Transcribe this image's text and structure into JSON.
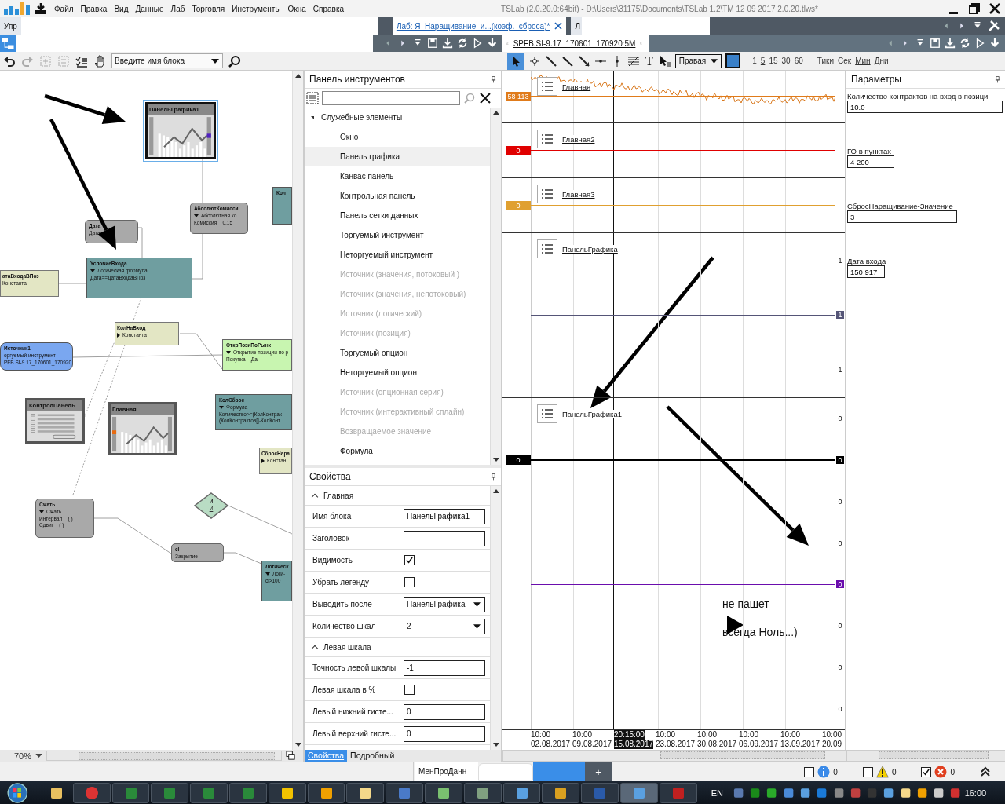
{
  "title_bar": {
    "menu": [
      "Файл",
      "Правка",
      "Вид",
      "Данные",
      "Лаб",
      "Торговля",
      "Инструменты",
      "Окна",
      "Справка"
    ],
    "title": "TSLab (2.0.20.0:64bit) - D:\\Users\\31175\\Documents\\TSLab 1.2\\TM 12 09 2017 2.0.20.tlws*"
  },
  "document_tabs": [
    {
      "label": "Упр",
      "selected": false
    },
    {
      "label": "Лаб: Я_Наращивание_и...(коэф._сброса)*",
      "selected": true
    },
    {
      "label": "Л",
      "selected": false
    }
  ],
  "chart_tab": {
    "label": "SPFB.SI-9.17_170601_170920:5M"
  },
  "editor_toolbar": {
    "block_search": {
      "placeholder": "Введите имя блока"
    }
  },
  "chart_toolbar": {
    "text_tool": "T",
    "scale": "Правая",
    "periods": [
      {
        "label": "1",
        "selected": false
      },
      {
        "label": "5",
        "selected": true
      },
      {
        "label": "15",
        "selected": false
      },
      {
        "label": "30",
        "selected": false
      },
      {
        "label": "60",
        "selected": false
      }
    ],
    "units": [
      {
        "label": "Тики",
        "selected": false
      },
      {
        "label": "Сек",
        "selected": false
      },
      {
        "label": "Мин",
        "selected": true
      },
      {
        "label": "Дни",
        "selected": false
      }
    ]
  },
  "canvas": {
    "zoom": "70%",
    "nodes": [
      {
        "kind": "panel",
        "title": "ПанельГрафика1",
        "selected": true
      },
      {
        "kind": "gray",
        "title": "Дата",
        "subtitle": "Дата",
        "selected": false
      },
      {
        "kind": "gray",
        "title": "АбсолютКомисси",
        "subtitle": {
          "text": "Абсолютная ко...",
          "expanded": true
        },
        "lines": [
          {
            "label": "Комиссия",
            "value": "0.15"
          }
        ],
        "selected": false
      },
      {
        "kind": "teal",
        "title": "Кол",
        "selected": false
      },
      {
        "kind": "teal",
        "title": "УсловиеВхода",
        "subtitle": {
          "text": "Логическая формула",
          "expanded": true
        },
        "lines": [
          "Дата==ДатаВходаВПоз"
        ],
        "selected": false
      },
      {
        "kind": "yellow",
        "title": "атаВходаВПоз",
        "subtitle": "Константа",
        "selected": false
      },
      {
        "kind": "yellow",
        "title": "КолНаВход",
        "subtitle": {
          "text": "Константа",
          "expanded": false
        },
        "selected": false
      },
      {
        "kind": "blue",
        "title": "Источник1",
        "subtitle": "оргуемый инструмент",
        "lines": [
          "PFB.SI-9.17_170601_170920"
        ],
        "selected": false
      },
      {
        "kind": "green",
        "title": "ОткрПозиПоРынк",
        "subtitle": {
          "text": "Открытие позиции по р",
          "expanded": true
        },
        "lines": [
          {
            "label": "Покупка",
            "value": "Да"
          }
        ],
        "selected": false
      },
      {
        "kind": "control",
        "title": "КонтролПанель",
        "selected": false
      },
      {
        "kind": "panel",
        "title": "Главная",
        "selected": false
      },
      {
        "kind": "teal",
        "title": "КолСброс",
        "subtitle": {
          "text": "Формула",
          "expanded": true
        },
        "lines": [
          "Количество>=(КолКонтрак",
          "(КолКонтрактов[]-КолКонт"
        ],
        "selected": false
      },
      {
        "kind": "yellow",
        "title": "СбросНара",
        "subtitle": {
          "text": "Констан",
          "expanded": false
        },
        "selected": false
      },
      {
        "kind": "diamond",
        "title": "И",
        "subtitle": "И",
        "selected": false
      },
      {
        "kind": "gray",
        "title": "Сжать",
        "subtitle": {
          "text": "Сжать",
          "expanded": true
        },
        "lines": [
          {
            "label": "Интервал",
            "value": "( )"
          },
          {
            "label": "Сдвиг",
            "value": "( )"
          }
        ],
        "selected": false
      },
      {
        "kind": "gray",
        "title": "cl",
        "subtitle": "Закрытие",
        "selected": false
      },
      {
        "kind": "teal",
        "title": "Логическ",
        "subtitle": {
          "text": "Логи-",
          "expanded": true
        },
        "lines": [
          "cl>100"
        ],
        "selected": false
      }
    ]
  },
  "toolbox": {
    "title": "Панель инструментов",
    "group": {
      "label": "Служебные элементы",
      "expanded": true,
      "items": [
        {
          "label": "Окно",
          "selected": false,
          "disabled": false
        },
        {
          "label": "Панель графика",
          "selected": true,
          "disabled": false
        },
        {
          "label": "Канвас панель",
          "selected": false,
          "disabled": false
        },
        {
          "label": "Контрольная панель",
          "selected": false,
          "disabled": false
        },
        {
          "label": "Панель сетки данных",
          "selected": false,
          "disabled": false
        },
        {
          "label": "Торгуемый инструмент",
          "selected": false,
          "disabled": false
        },
        {
          "label": "Неторгуемый инструмент",
          "selected": false,
          "disabled": false
        },
        {
          "label": "Источник (значения, потоковый )",
          "selected": false,
          "disabled": true
        },
        {
          "label": "Источник (значения, непотоковый)",
          "selected": false,
          "disabled": true
        },
        {
          "label": "Источник (логический)",
          "selected": false,
          "disabled": true
        },
        {
          "label": "Источник (позиция)",
          "selected": false,
          "disabled": true
        },
        {
          "label": "Торгуемый опцион",
          "selected": false,
          "disabled": false
        },
        {
          "label": "Неторгуемый опцион",
          "selected": false,
          "disabled": false
        },
        {
          "label": "Источник (опционная серия)",
          "selected": false,
          "disabled": true
        },
        {
          "label": "Источник (интерактивный сплайн)",
          "selected": false,
          "disabled": true
        },
        {
          "label": "Возвращаемое значение",
          "selected": false,
          "disabled": true
        },
        {
          "label": "Формула",
          "selected": false,
          "disabled": false
        }
      ]
    }
  },
  "properties": {
    "title": "Свойства",
    "sections": [
      {
        "label": "Главная",
        "expanded": true,
        "rows": [
          {
            "label": "Имя блока",
            "kind": "text",
            "value": "ПанельГрафика1"
          },
          {
            "label": "Заголовок",
            "kind": "text"
          },
          {
            "label": "Видимость",
            "kind": "checkbox",
            "checked": true
          },
          {
            "label": "Убрать легенду",
            "kind": "checkbox",
            "checked": false
          },
          {
            "label": "Выводить после",
            "kind": "dropdown",
            "value": "ПанельГрафика"
          },
          {
            "label": "Количество шкал",
            "kind": "dropdown",
            "value": "2"
          }
        ]
      },
      {
        "label": "Левая шкала",
        "expanded": true,
        "rows": [
          {
            "label": "Точность левой шкалы",
            "kind": "text",
            "value": "-1"
          },
          {
            "label": "Левая шкала в %",
            "kind": "checkbox",
            "checked": false
          },
          {
            "label": "Левый нижний гисте...",
            "kind": "text",
            "value": "0"
          },
          {
            "label": "Левый верхний гисте...",
            "kind": "text",
            "value": "0"
          }
        ]
      }
    ],
    "tabs": [
      {
        "label": "Свойства",
        "selected": true
      },
      {
        "label": "Подробный",
        "selected": false
      }
    ]
  },
  "chart": {
    "panes": [
      {
        "kind": "price",
        "legend": "Главная",
        "rows": [
          {
            "left_label": "58 113",
            "color": "#e07b1a"
          }
        ]
      },
      {
        "kind": "indicator",
        "legend": "Главная2",
        "rows": [
          {
            "left_label": "0",
            "color": "#e00000"
          }
        ]
      },
      {
        "kind": "indicator",
        "legend": "Главная3",
        "rows": [
          {
            "left_label": "0",
            "color": "#e0a030"
          }
        ]
      },
      {
        "kind": "indicator",
        "legend": "ПанельГрафика",
        "rows": [
          {
            "right_label": "1"
          },
          {
            "right_label": "1",
            "color": "#555577"
          },
          {
            "right_label": "1"
          }
        ]
      },
      {
        "kind": "indicator",
        "legend": "ПанельГрафика1",
        "rows": [
          {
            "right_label": "0"
          },
          {
            "left_label": "0",
            "right_label": "0",
            "color": "#000000"
          },
          {
            "right_label": "0"
          },
          {
            "right_label": "0"
          },
          {
            "right_label": "0",
            "color": "#6a0dad"
          },
          {
            "right_label": "0"
          },
          {
            "right_label": "0"
          },
          {
            "right_label": "0"
          }
        ]
      }
    ],
    "time_axis": [
      {
        "time": "10:00",
        "date": "02.08.2017",
        "selected": false
      },
      {
        "time": "10:00",
        "date": "09.08.2017",
        "selected": false
      },
      {
        "time": "20:15:00",
        "date": "15.08.2017",
        "selected": true
      },
      {
        "time": "10:00",
        "date": "23.08.2017",
        "selected": false
      },
      {
        "time": "10:00",
        "date": "30.08.2017",
        "selected": false
      },
      {
        "time": "10:00",
        "date": "06.09.2017",
        "selected": false
      },
      {
        "time": "10:00",
        "date": "13.09.2017",
        "selected": false
      },
      {
        "time": "10:00",
        "date": "20.09",
        "selected": false
      }
    ],
    "notes": [
      "не пашет",
      "всегда Ноль...)"
    ]
  },
  "parameters": {
    "title": "Параметры",
    "items": [
      {
        "label": "Количество контрактов на вход в позици",
        "value": "10.0"
      },
      {
        "label": "ГО в пунктах",
        "value": "4 200"
      },
      {
        "label": "СбросНаращивание-Значение",
        "value": "3"
      },
      {
        "label": "Дата входа",
        "value": "150 917"
      }
    ]
  },
  "status_bar": {
    "tabs": [
      {
        "label": "МенПроДанн"
      }
    ],
    "add": "+",
    "filters": [
      {
        "kind": "info",
        "checked": false,
        "count": "0"
      },
      {
        "kind": "warning",
        "checked": false,
        "count": "0"
      },
      {
        "kind": "error",
        "checked": true,
        "count": "0"
      }
    ]
  },
  "taskbar": {
    "language": "EN",
    "clock": "16:00"
  }
}
